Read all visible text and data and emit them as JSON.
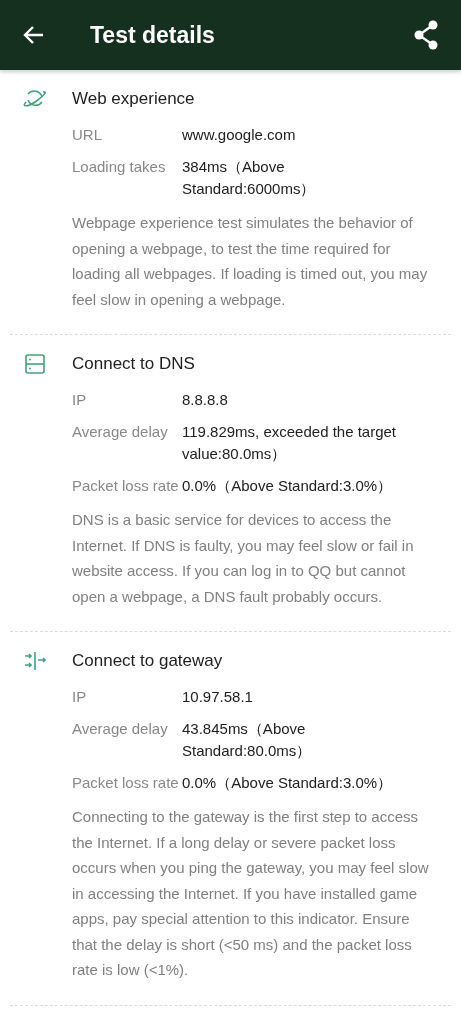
{
  "app_bar": {
    "title": "Test details"
  },
  "sections": [
    {
      "kind": "web",
      "title": "Web experience",
      "rows": [
        {
          "label": "URL",
          "value": "www.google.com"
        },
        {
          "label": "Loading takes",
          "value": "384ms（Above Standard:6000ms）"
        }
      ],
      "description": "Webpage experience test simulates the behavior of opening a webpage, to test the time required for loading all webpages. If loading is timed out, you may feel slow in opening a webpage."
    },
    {
      "kind": "dns",
      "title": "Connect to DNS",
      "rows": [
        {
          "label": "IP",
          "value": "8.8.8.8"
        },
        {
          "label": "Average delay",
          "value": "119.829ms, exceeded the target value:80.0ms）"
        },
        {
          "label": "Packet loss rate",
          "value": "0.0%（Above Standard:3.0%）"
        }
      ],
      "description": "DNS is a basic service for devices to access the Internet. If DNS is faulty, you may feel slow or fail in website access. If you can log in to QQ but cannot open a webpage, a DNS fault probably occurs."
    },
    {
      "kind": "gateway",
      "title": "Connect to gateway",
      "rows": [
        {
          "label": "IP",
          "value": "10.97.58.1"
        },
        {
          "label": "Average delay",
          "value": "43.845ms（Above Standard:80.0ms）"
        },
        {
          "label": "Packet loss rate",
          "value": "0.0%（Above Standard:3.0%）"
        }
      ],
      "description": "Connecting to the gateway is the first step to access the Internet. If a long delay or severe packet loss occurs when you ping the gateway, you may feel slow in accessing the Internet. If you have installed game apps, pay special attention to this indicator. Ensure that the delay is short (<50 ms) and the packet loss rate is low (<1%)."
    }
  ]
}
